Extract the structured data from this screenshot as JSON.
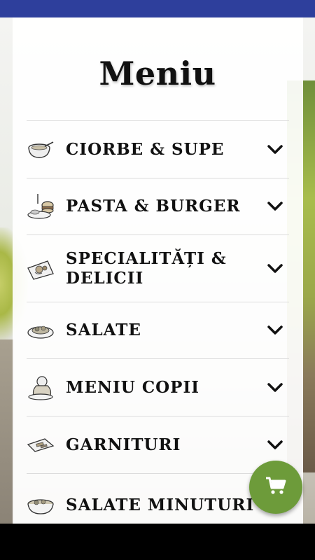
{
  "header": {
    "title": "Meniu"
  },
  "menu": {
    "items": [
      {
        "label": "CIORBE & SUPE",
        "icon": "soup-bowl-icon"
      },
      {
        "label": "PASTA & BURGER",
        "icon": "burger-icon"
      },
      {
        "label": "SPECIALITĂȚI & DELICII",
        "icon": "specialty-dish-icon"
      },
      {
        "label": "SALATE",
        "icon": "salad-icon"
      },
      {
        "label": "MENIU COPII",
        "icon": "kids-meal-icon"
      },
      {
        "label": "GARNITURI",
        "icon": "side-dish-icon"
      },
      {
        "label": "SALATE MINUTURI",
        "icon": "salad-bowl-icon"
      }
    ]
  },
  "cart": {
    "icon": "cart-icon",
    "color": "#6d9b3a"
  },
  "colors": {
    "status_bar": "#2e3f9c",
    "accent": "#6d9b3a"
  }
}
